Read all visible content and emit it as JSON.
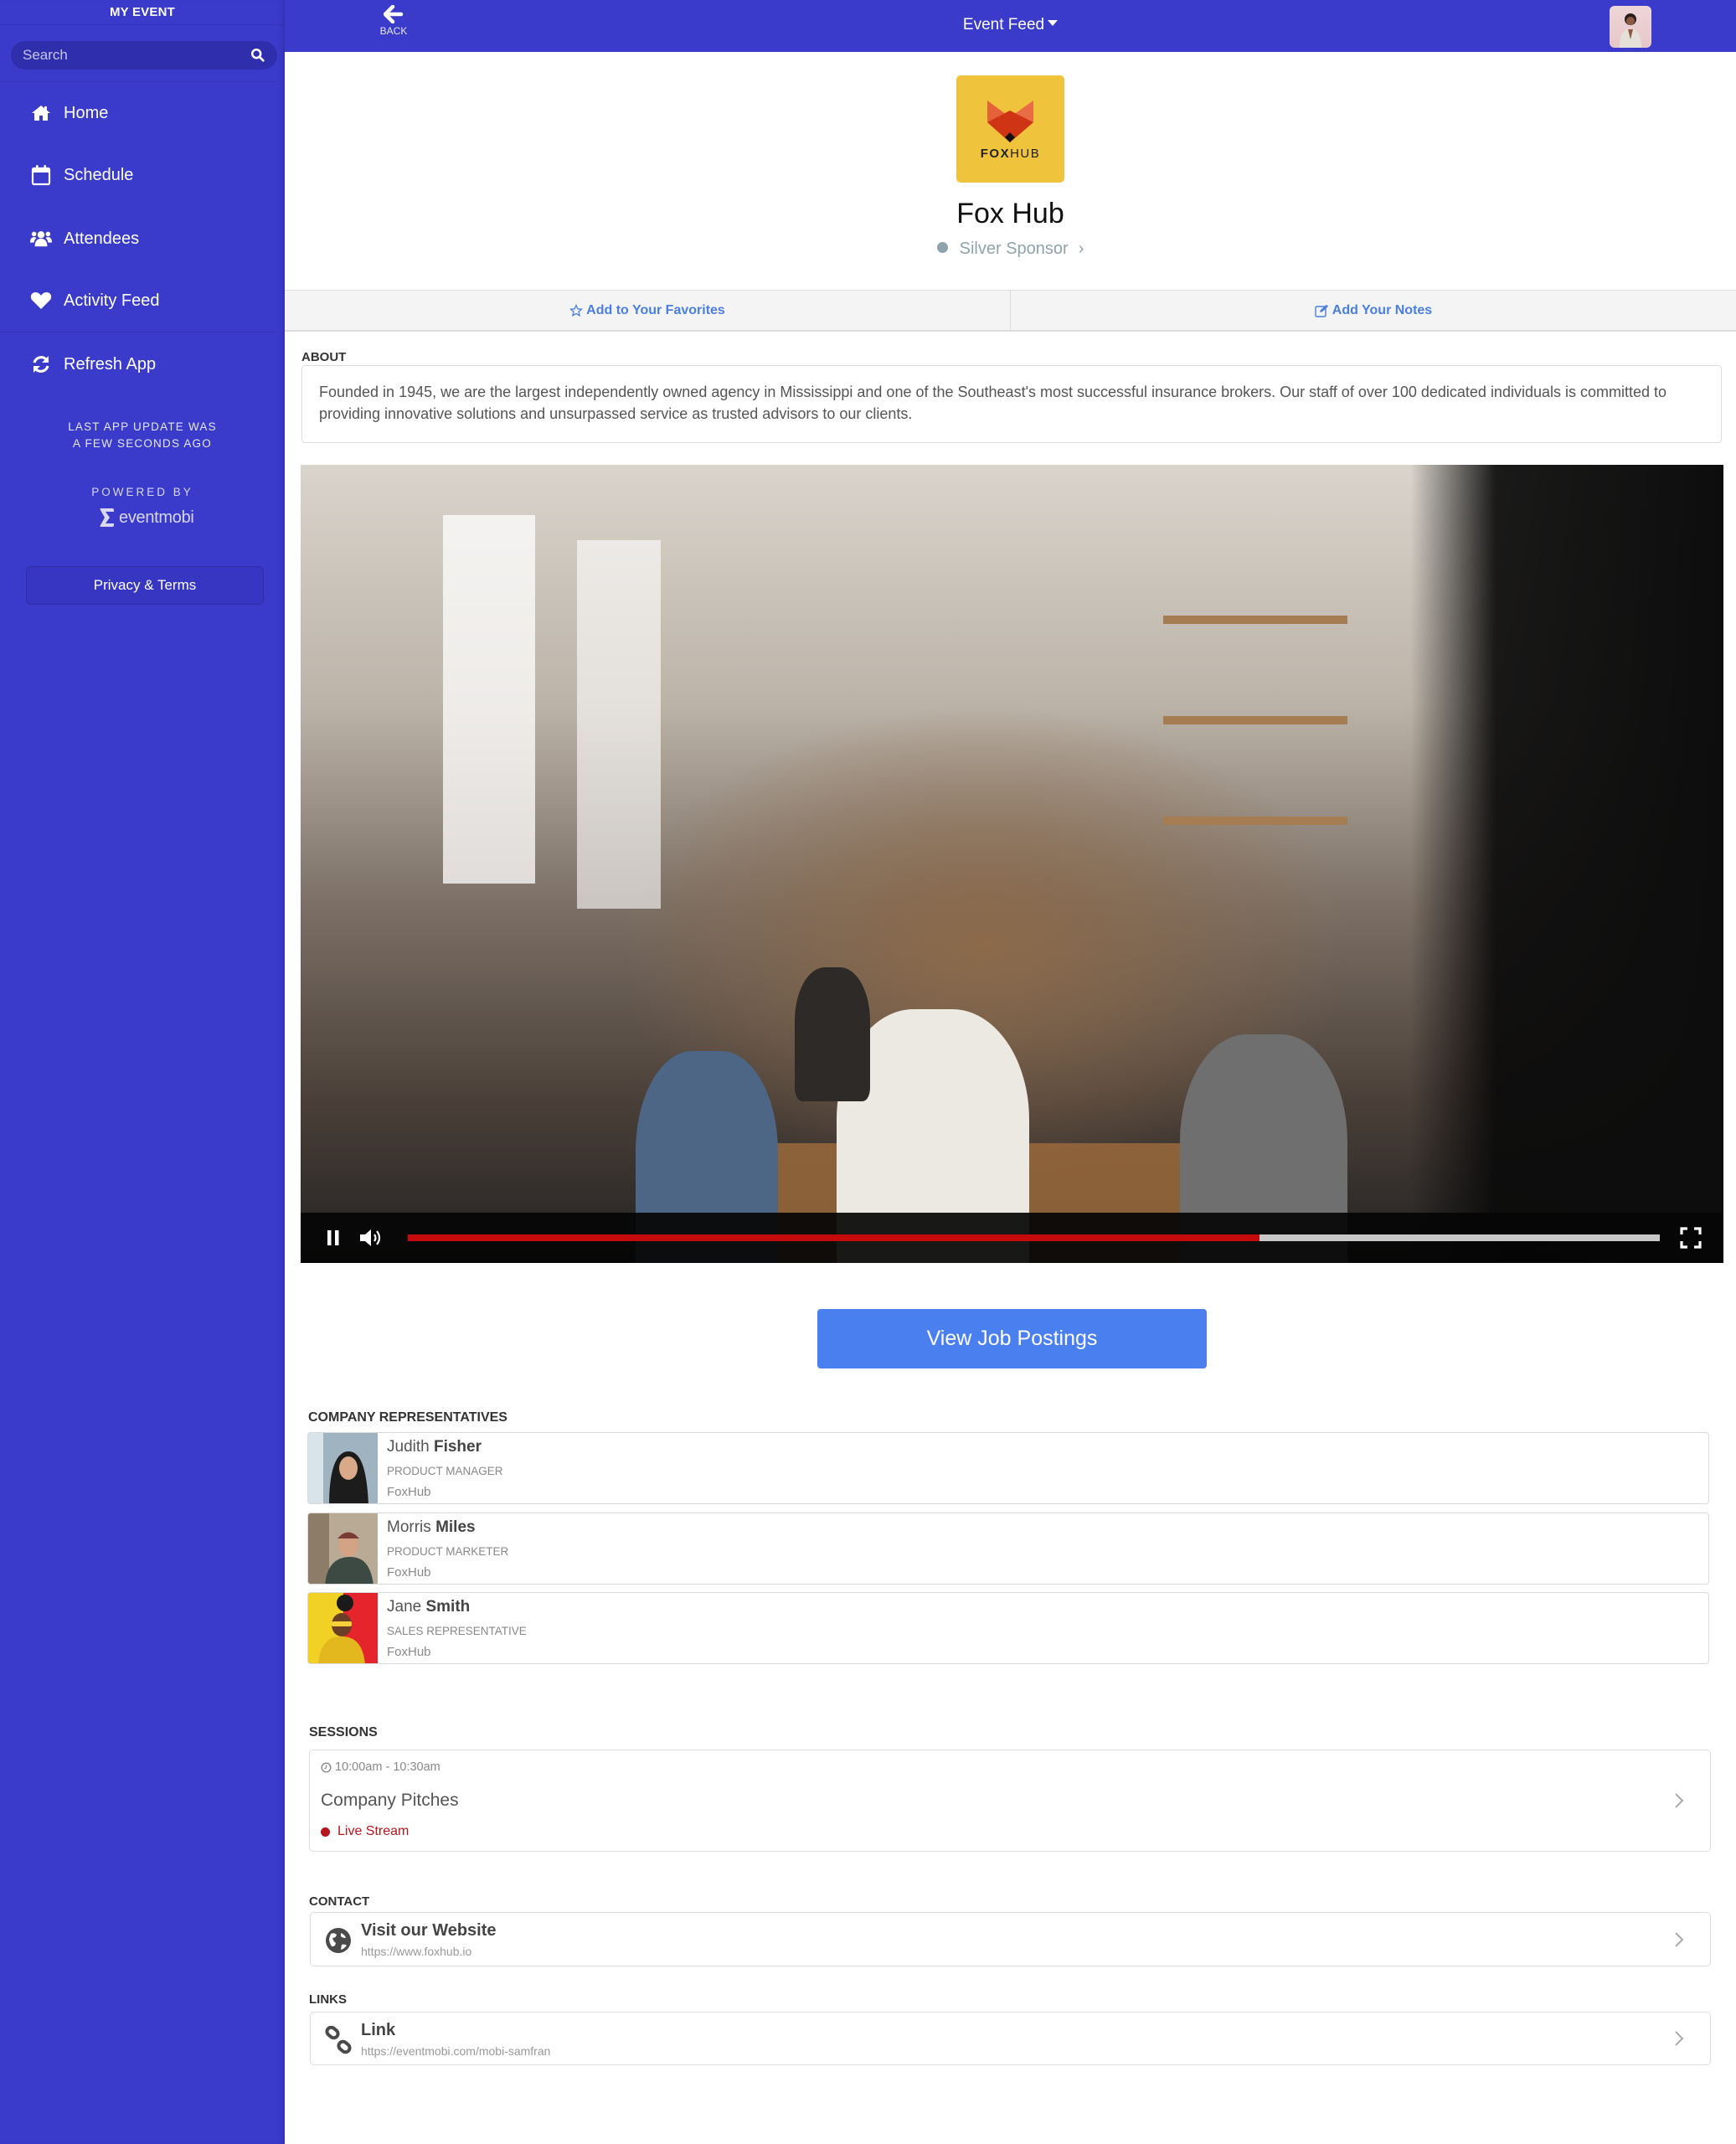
{
  "sidebar": {
    "title": "MY EVENT",
    "search_placeholder": "Search",
    "items": [
      {
        "label": "Home",
        "icon": "home-icon"
      },
      {
        "label": "Schedule",
        "icon": "calendar-icon"
      },
      {
        "label": "Attendees",
        "icon": "users-icon"
      },
      {
        "label": "Activity Feed",
        "icon": "heart-icon"
      },
      {
        "label": "Refresh App",
        "icon": "refresh-icon"
      }
    ],
    "update_line1": "LAST APP UPDATE WAS",
    "update_line2": "A FEW SECONDS AGO",
    "powered_by": "POWERED BY",
    "brand": "eventmobi",
    "privacy_label": "Privacy & Terms"
  },
  "header": {
    "back_label": "BACK",
    "feed_label": "Event Feed",
    "bg_color": "#3a3acb"
  },
  "company": {
    "logo_bold": "FOX",
    "logo_light": "HUB",
    "name": "Fox Hub",
    "sponsor_level": "Silver Sponsor",
    "logo_bg": "#f0c33c"
  },
  "actions": {
    "favorites_label": "Add to Your Favorites",
    "notes_label": "Add Your Notes",
    "accent": "#4a7fe0"
  },
  "about": {
    "label": "ABOUT",
    "text": "Founded in 1945, we are the largest independently owned agency in Mississippi and one of the Southeast's most successful insurance brokers.  Our staff of over 100 dedicated individuals is committed to providing innovative solutions and unsurpassed service as trusted advisors to our clients."
  },
  "video": {
    "state": "playing",
    "progress_percent": 68,
    "progress_color": "#c40a0a"
  },
  "job_button_label": "View Job Postings",
  "representatives": {
    "label": "COMPANY REPRESENTATIVES",
    "items": [
      {
        "first": "Judith",
        "last": "Fisher",
        "title": "PRODUCT MANAGER",
        "company": "FoxHub"
      },
      {
        "first": "Morris",
        "last": "Miles",
        "title": "PRODUCT MARKETER",
        "company": "FoxHub"
      },
      {
        "first": "Jane",
        "last": "Smith",
        "title": "SALES REPRESENTATIVE",
        "company": "FoxHub"
      }
    ]
  },
  "sessions": {
    "label": "SESSIONS",
    "items": [
      {
        "time": "10:00am - 10:30am",
        "title": "Company Pitches",
        "badge": "Live Stream",
        "badge_color": "#b5151b"
      }
    ]
  },
  "contact": {
    "label": "CONTACT",
    "items": [
      {
        "title": "Visit our Website",
        "url": "https://www.foxhub.io",
        "icon": "globe-icon"
      }
    ]
  },
  "links": {
    "label": "LINKS",
    "items": [
      {
        "title": "Link",
        "url": "https://eventmobi.com/mobi-samfran",
        "icon": "link-icon"
      }
    ]
  }
}
